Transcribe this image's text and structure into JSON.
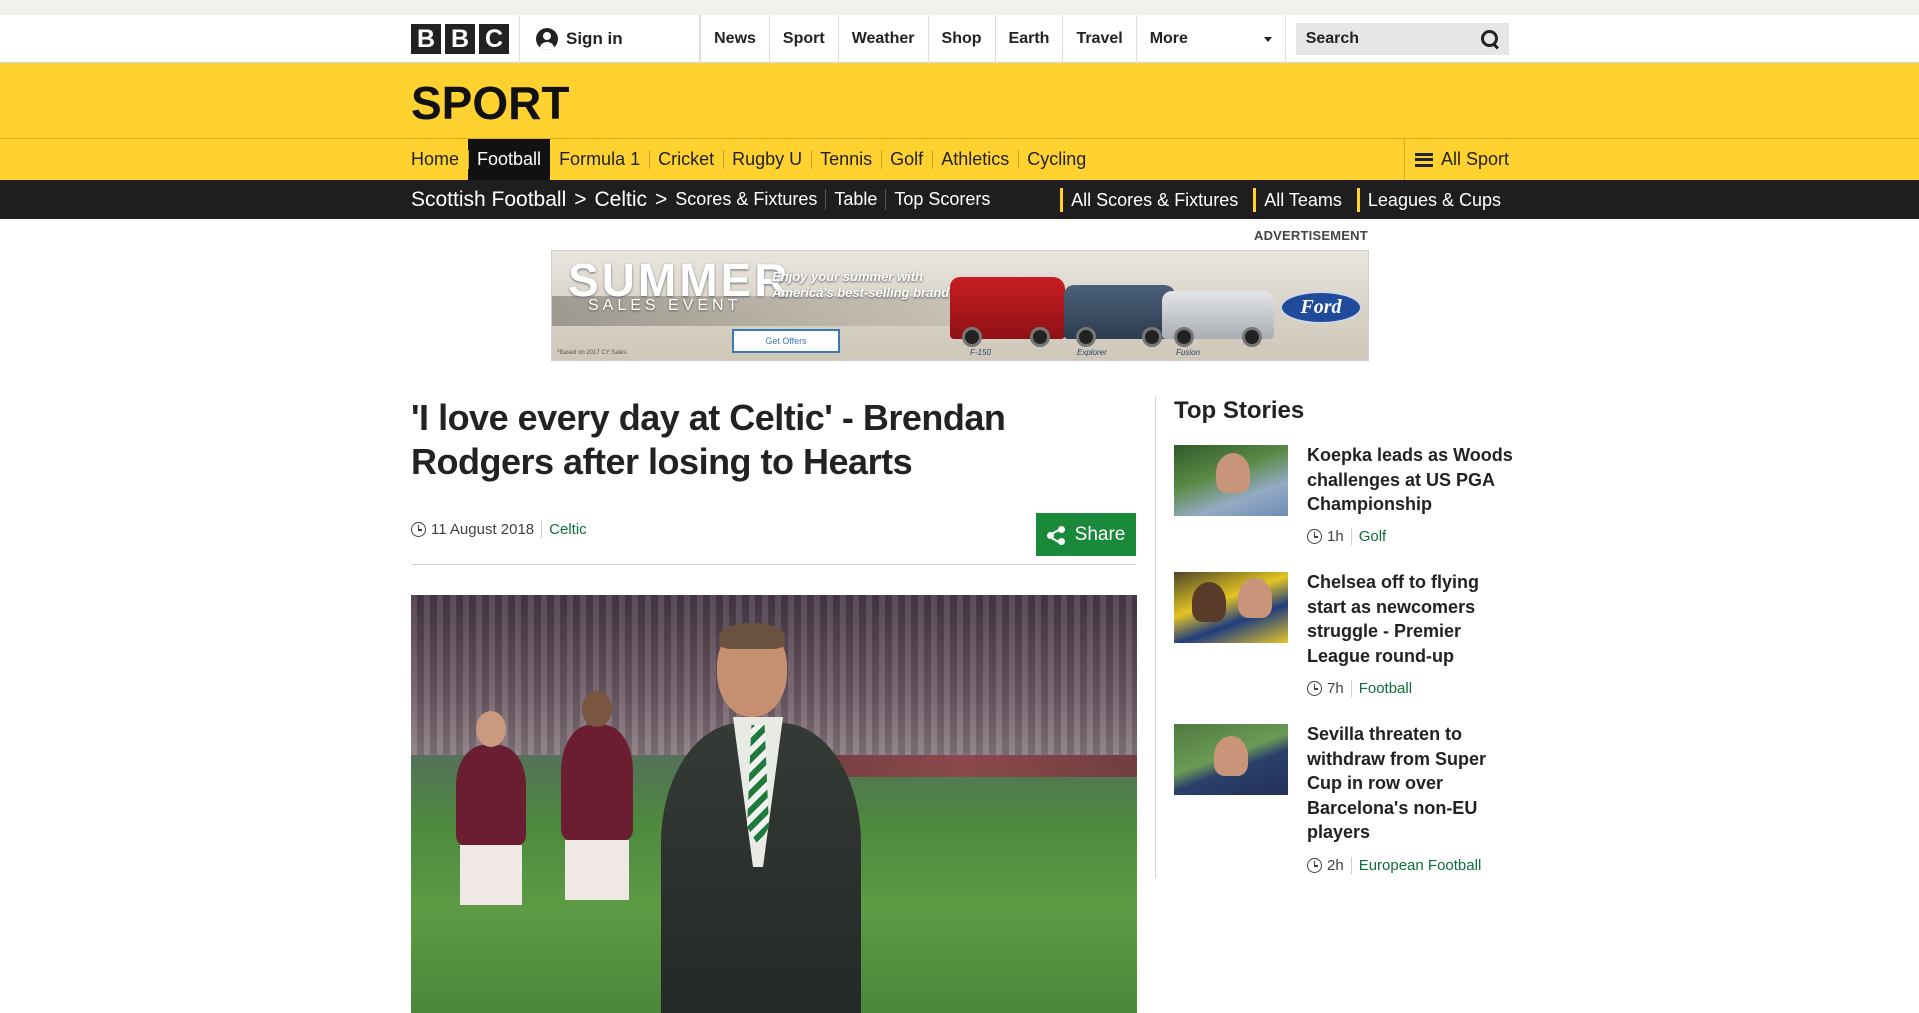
{
  "bbc_bar": {
    "logo_letters": [
      "B",
      "B",
      "C"
    ],
    "sign_in": "Sign in",
    "nav": [
      "News",
      "Sport",
      "Weather",
      "Shop",
      "Earth",
      "Travel"
    ],
    "more": "More",
    "search_placeholder": "Search"
  },
  "sport": {
    "title": "SPORT",
    "nav": [
      "Home",
      "Football",
      "Formula 1",
      "Cricket",
      "Rugby U",
      "Tennis",
      "Golf",
      "Athletics",
      "Cycling"
    ],
    "active_nav": "Football",
    "all_sport": "All Sport"
  },
  "subnav": {
    "breadcrumb": [
      "Scottish Football",
      "Celtic"
    ],
    "breadcrumb_separator": ">",
    "items": [
      "Scores & Fixtures",
      "Table",
      "Top Scorers"
    ],
    "right_items": [
      "All Scores & Fixtures",
      "All Teams",
      "Leagues & Cups"
    ]
  },
  "advertisement": {
    "label": "ADVERTISEMENT",
    "headline": "SUMMER",
    "subheadline": "SALES EVENT",
    "tagline": "Enjoy your summer with America's best-selling brand*",
    "cta": "Get Offers",
    "fine_print": "*Based on 2017 CY Sales.",
    "models": [
      "F-150",
      "Explorer",
      "Fusion"
    ],
    "brand": "Ford"
  },
  "article": {
    "headline": "'I love every day at Celtic' - Brendan Rodgers after losing to Hearts",
    "date": "11 August 2018",
    "section": "Celtic",
    "share_label": "Share"
  },
  "top_stories": {
    "heading": "Top Stories",
    "items": [
      {
        "title": "Koepka leads as Woods challenges at US PGA Championship",
        "time": "1h",
        "section": "Golf"
      },
      {
        "title": "Chelsea off to flying start as newcomers struggle - Premier League round-up",
        "time": "7h",
        "section": "Football"
      },
      {
        "title": "Sevilla threaten to withdraw from Super Cup in row over Barcelona's non-EU players",
        "time": "2h",
        "section": "European Football"
      }
    ]
  },
  "colors": {
    "sport_yellow": "#ffd230",
    "subnav_black": "#1e1e1e",
    "link_green": "#0d6e39",
    "share_green": "#1a8a3a"
  },
  "icons": [
    "user-icon",
    "caret-down-icon",
    "search-icon",
    "menu-icon",
    "clock-icon",
    "share-icon"
  ]
}
